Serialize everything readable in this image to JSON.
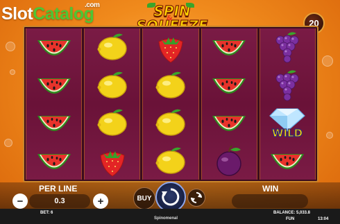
{
  "watermark": {
    "part1": "Slot",
    "part2": "Catalog",
    "suffix": ".com"
  },
  "game_logo": {
    "line1": "SPIN",
    "amp": "&",
    "line2": "SQUEEZE"
  },
  "paylines_badge": "20",
  "reels": [
    [
      "watermelon",
      "watermelon",
      "watermelon",
      "watermelon"
    ],
    [
      "lemon",
      "lemon",
      "lemon",
      "strawberry"
    ],
    [
      "strawberry",
      "lemon",
      "lemon",
      "lemon"
    ],
    [
      "watermelon",
      "watermelon",
      "watermelon",
      "plum"
    ],
    [
      "grapes",
      "grapes",
      "wild",
      "watermelon"
    ]
  ],
  "wild_label": "WILD",
  "controls": {
    "per_line_label": "PER LINE",
    "per_line_value": "0.3",
    "minus_label": "−",
    "plus_label": "+",
    "buy_label": "BUY",
    "win_label": "WIN",
    "win_value": ""
  },
  "status": {
    "bet": "BET: 6",
    "balance": "BALANCE: 5,033.8",
    "provider": "Spinomenal",
    "mode": "FUN",
    "time": "13:04"
  },
  "colors": {
    "background": "#f08a1c",
    "reel_bg": "#6a1238",
    "frame": "#c9862a",
    "logo_yellow": "#ffd400",
    "watermark_green": "#4fc534"
  }
}
